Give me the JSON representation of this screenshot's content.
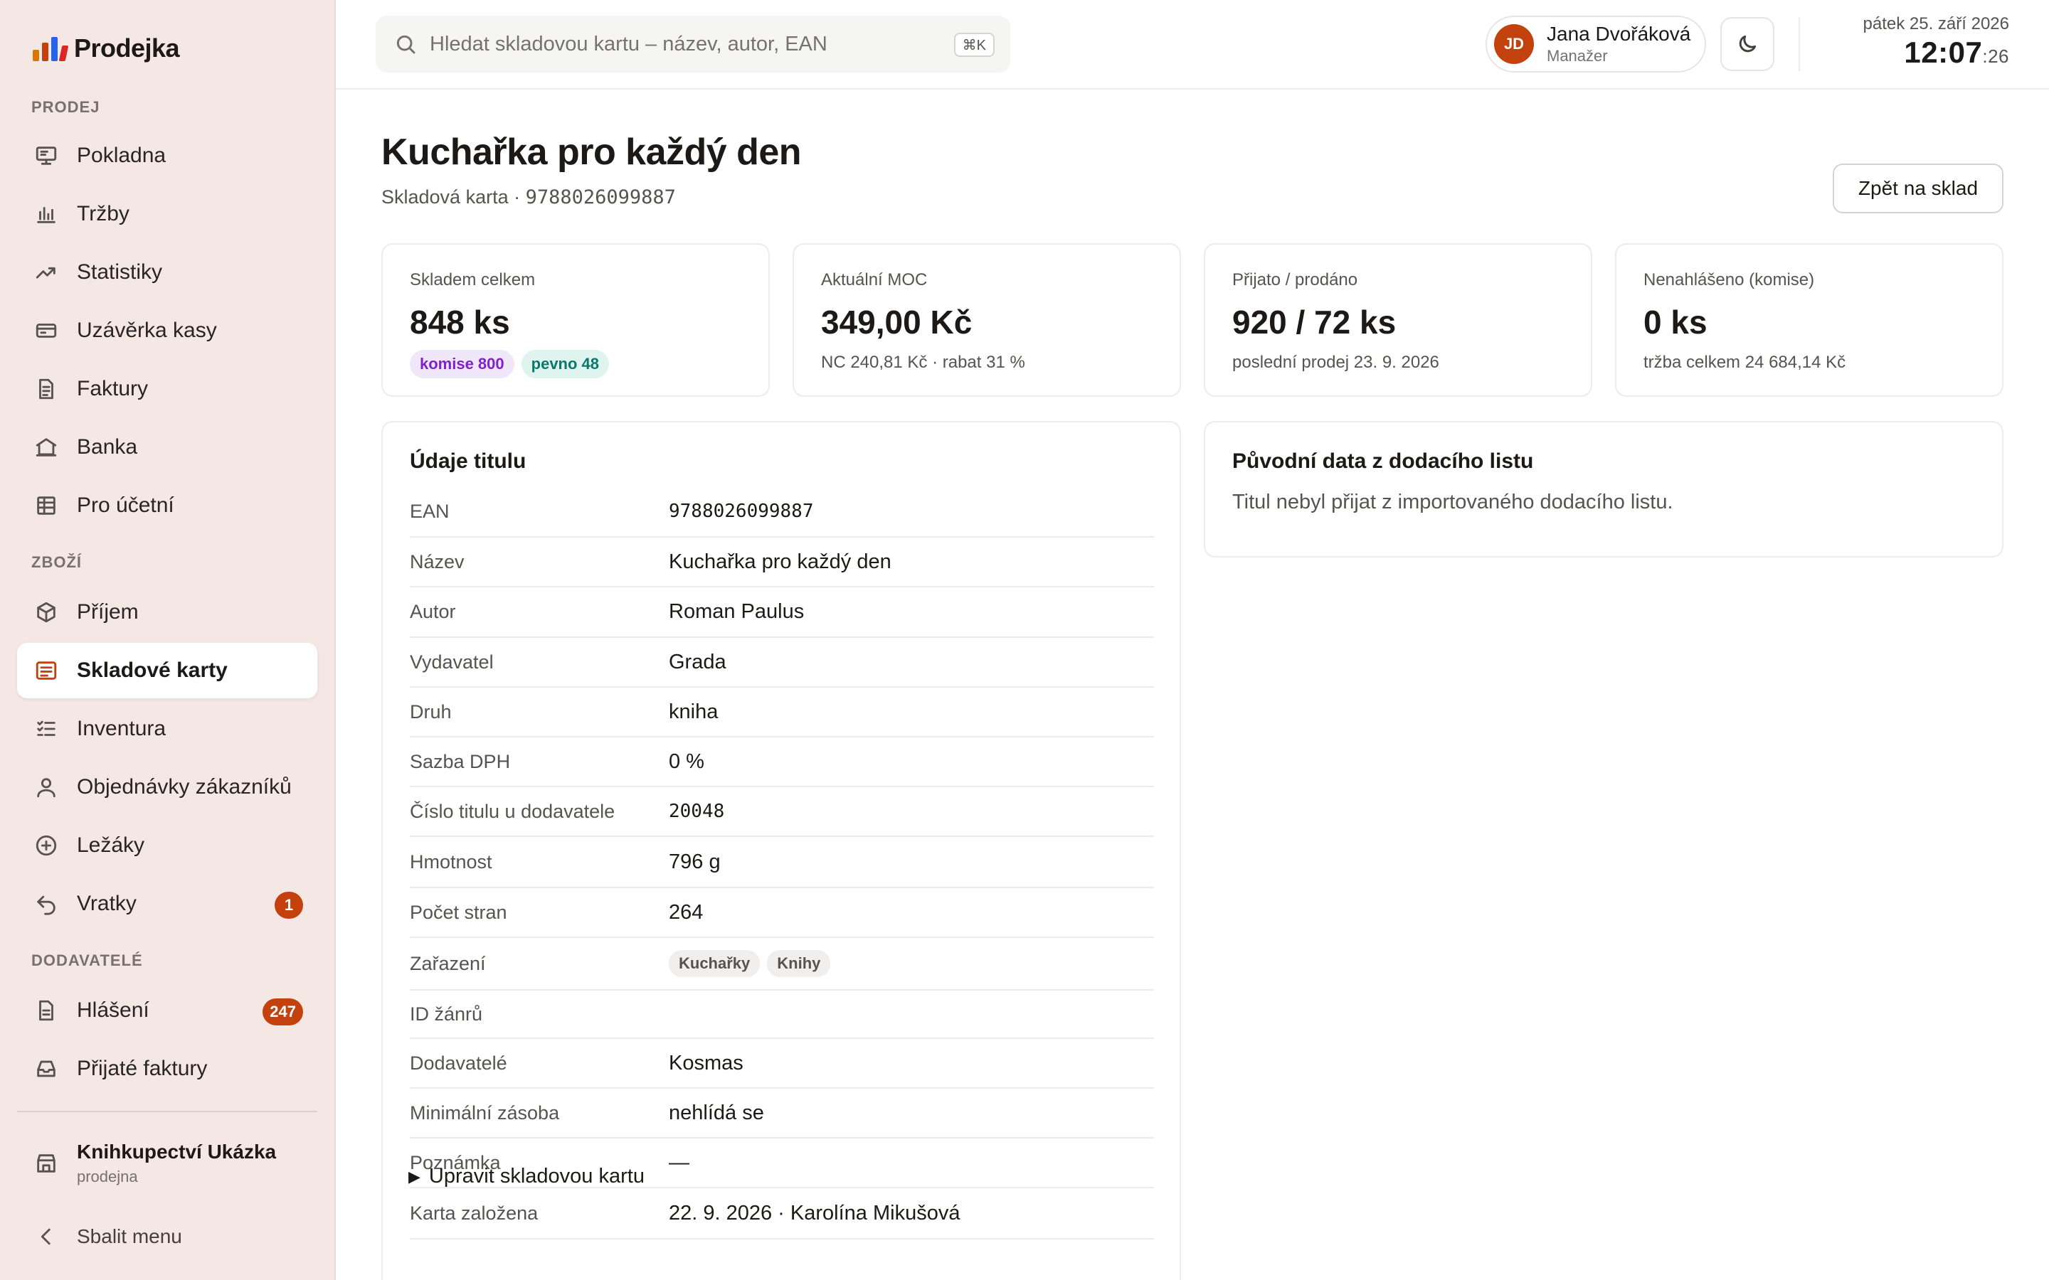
{
  "app": {
    "name": "Prodejka"
  },
  "brand": {
    "accent": "#c2410c",
    "logo_colors": [
      "#d97706",
      "#c2410c",
      "#2563eb",
      "#dc2626"
    ]
  },
  "sidebar": {
    "sections": [
      {
        "label": "PRODEJ",
        "items": [
          {
            "label": "Pokladna",
            "icon": "monitor-icon"
          },
          {
            "label": "Tržby",
            "icon": "bar-chart-icon"
          },
          {
            "label": "Statistiky",
            "icon": "trend-icon"
          },
          {
            "label": "Uzávěrka kasy",
            "icon": "cash-register-icon"
          },
          {
            "label": "Faktury",
            "icon": "document-icon"
          },
          {
            "label": "Banka",
            "icon": "bank-icon"
          },
          {
            "label": "Pro účetní",
            "icon": "table-icon"
          }
        ]
      },
      {
        "label": "ZBOŽÍ",
        "items": [
          {
            "label": "Příjem",
            "icon": "box-icon"
          },
          {
            "label": "Skladové karty",
            "icon": "card-list-icon",
            "active": true
          },
          {
            "label": "Inventura",
            "icon": "checklist-icon"
          },
          {
            "label": "Objednávky zákazníků",
            "icon": "user-icon"
          },
          {
            "label": "Ležáky",
            "icon": "plus-circle-icon"
          },
          {
            "label": "Vratky",
            "icon": "undo-icon",
            "badge": "1"
          }
        ]
      },
      {
        "label": "DODAVATELÉ",
        "items": [
          {
            "label": "Hlášení",
            "icon": "report-icon",
            "badge": "247"
          },
          {
            "label": "Přijaté faktury",
            "icon": "inbox-icon"
          }
        ]
      }
    ],
    "store": {
      "name": "Knihkupectví Ukázka",
      "type": "prodejna"
    },
    "collapse_label": "Sbalit menu"
  },
  "topbar": {
    "search": {
      "placeholder": "Hledat skladovou kartu – název, autor, EAN",
      "value": "",
      "shortcut": "⌘K"
    },
    "user": {
      "initials": "JD",
      "name": "Jana Dvořáková",
      "role": "Manažer"
    },
    "clock": {
      "date": "pátek 25. září 2026",
      "time": "12:07",
      "seconds": ":26"
    }
  },
  "page": {
    "title": "Kuchařka pro každý den",
    "subtitle_prefix": "Skladová karta · ",
    "ean": "9788026099887",
    "back_label": "Zpět na sklad"
  },
  "stats": [
    {
      "label": "Skladem celkem",
      "value": "848 ks",
      "pills": [
        "komise 800",
        "pevno 48"
      ]
    },
    {
      "label": "Aktuální MOC",
      "value": "349,00 Kč",
      "sub": "NC 240,81 Kč · rabat 31 %"
    },
    {
      "label": "Přijato / prodáno",
      "value": "920 / 72 ks",
      "sub": "poslední prodej 23. 9. 2026"
    },
    {
      "label": "Nenahlášeno (komise)",
      "value": "0 ks",
      "sub": "tržba celkem 24 684,14 Kč"
    }
  ],
  "details": {
    "title": "Údaje titulu",
    "rows": [
      {
        "label": "EAN",
        "value": "9788026099887",
        "mono": true
      },
      {
        "label": "Název",
        "value": "Kuchařka pro každý den"
      },
      {
        "label": "Autor",
        "value": "Roman Paulus"
      },
      {
        "label": "Vydavatel",
        "value": "Grada"
      },
      {
        "label": "Druh",
        "value": "kniha"
      },
      {
        "label": "Sazba DPH",
        "value": "0 %"
      },
      {
        "label": "Číslo titulu u dodavatele",
        "value": "20048",
        "mono": true
      },
      {
        "label": "Hmotnost",
        "value": "796 g"
      },
      {
        "label": "Počet stran",
        "value": "264"
      },
      {
        "label": "Zařazení",
        "tags": [
          "Kuchařky",
          "Knihy"
        ]
      },
      {
        "label": "ID žánrů",
        "value": ""
      },
      {
        "label": "Dodavatelé",
        "value": "Kosmas"
      },
      {
        "label": "Minimální zásoba",
        "value": "nehlídá se"
      },
      {
        "label": "Poznámka",
        "value": "—"
      },
      {
        "label": "Karta založena",
        "value": "22. 9. 2026 · Karolína Mikušová"
      }
    ],
    "edit_label": "Upravit skladovou kartu"
  },
  "original": {
    "title": "Původní data z dodacího listu",
    "text": "Titul nebyl přijat z importovaného dodacího listu."
  }
}
